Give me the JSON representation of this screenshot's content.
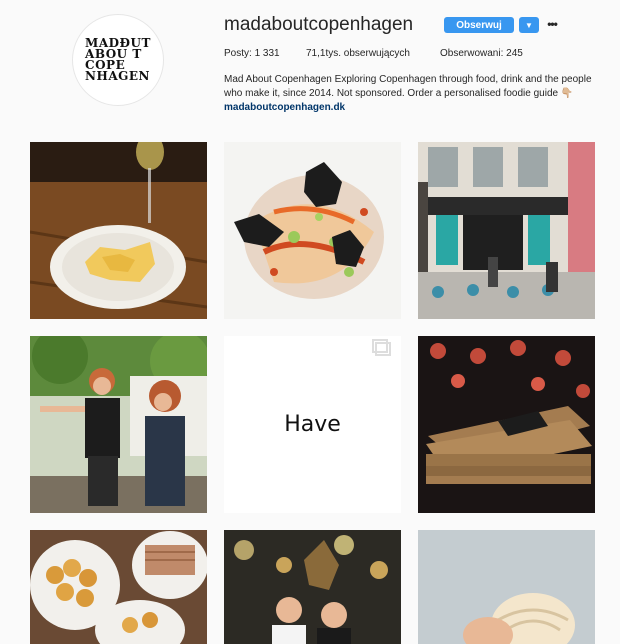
{
  "profile": {
    "avatar_logo_lines": [
      "MADƉUT",
      "ABOU T",
      "COPE",
      "NHAGEN"
    ],
    "username": "madaboutcopenhagen",
    "follow_label": "Obserwuj",
    "dropdown_icon": "chevron-down-icon",
    "more_icon": "more-options-icon",
    "stats": {
      "posts": "Posty: 1 331",
      "followers": "71,1tys. obserwujących",
      "following": "Obserwowani: 245"
    },
    "bio": {
      "text": "Mad About Copenhagen Exploring Copenhagen through food, drink and the people who make it, since 2014. Not sponsored. Order a personalised foodie guide",
      "emoji": "👇🏼",
      "link": "madaboutcopenhagen.dk"
    }
  },
  "posts": [
    {
      "alt": "plate with pasta and wine"
    },
    {
      "alt": "octopus dish with black crisps"
    },
    {
      "alt": "café storefront with outdoor seating"
    },
    {
      "alt": "two women in black dresses"
    },
    {
      "alt": "text post",
      "text": "Have",
      "multi_icon": "carousel-icon"
    },
    {
      "alt": "stack of brown boxes with ribbon"
    },
    {
      "alt": "potatoes and sliced roast"
    },
    {
      "alt": "chefs under christmas decorations"
    },
    {
      "alt": "hand holding bun"
    }
  ],
  "colors": {
    "accent": "#3897f0",
    "link": "#003569"
  }
}
